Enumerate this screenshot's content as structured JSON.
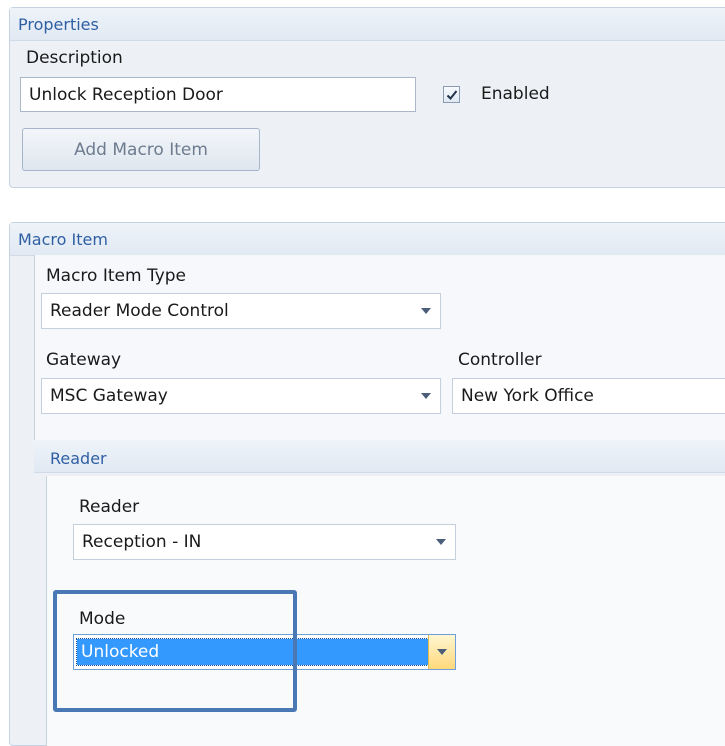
{
  "properties": {
    "title": "Properties",
    "description_label": "Description",
    "description_value": "Unlock Reception Door",
    "enabled_label": "Enabled",
    "enabled_checked": true,
    "add_button_label": "Add Macro Item"
  },
  "macro_item": {
    "title": "Macro Item",
    "type_label": "Macro Item Type",
    "type_value": "Reader Mode Control",
    "gateway_label": "Gateway",
    "gateway_value": "MSC Gateway",
    "controller_label": "Controller",
    "controller_value": "New York Office"
  },
  "reader_group": {
    "title": "Reader",
    "reader_label": "Reader",
    "reader_value": "Reception - IN",
    "mode_label": "Mode",
    "mode_value": "Unlocked"
  },
  "colors": {
    "panel_title": "#2f5fa3",
    "selection": "#3399ff",
    "highlight_border": "#4a78b5",
    "dropdown_active": "#ffe9a6"
  },
  "icons": {
    "dropdown": "chevron-down-icon",
    "checkbox": "checkmark-icon"
  }
}
